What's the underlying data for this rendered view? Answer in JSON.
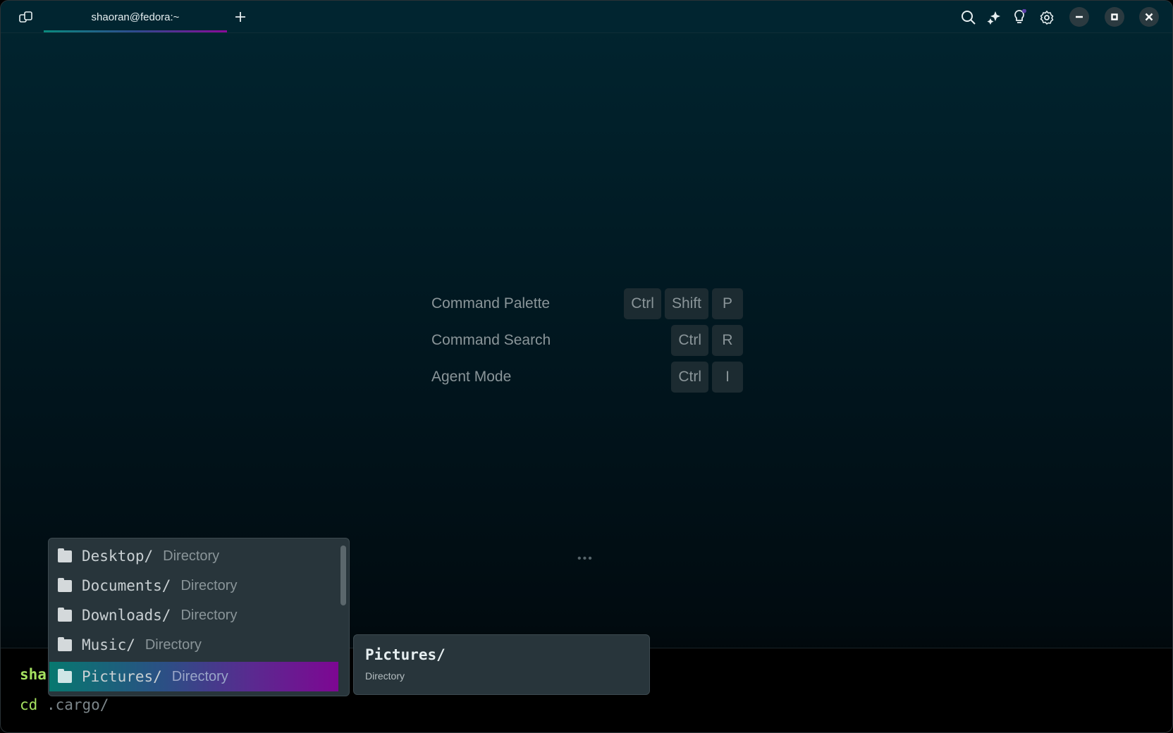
{
  "tab": {
    "title": "shaoran@fedora:~"
  },
  "toolbar": {
    "icons": [
      "panels-icon",
      "plus-icon",
      "search-icon",
      "sparkles-icon",
      "lightbulb-icon",
      "gear-icon",
      "minimize-icon",
      "maximize-icon",
      "close-icon"
    ],
    "notification_dot_color": "#5b3fa8"
  },
  "hints": [
    {
      "label": "Command Palette",
      "keys": [
        "Ctrl",
        "Shift",
        "P"
      ]
    },
    {
      "label": "Command Search",
      "keys": [
        "Ctrl",
        "R"
      ]
    },
    {
      "label": "Agent Mode",
      "keys": [
        "Ctrl",
        "I"
      ]
    }
  ],
  "terminal": {
    "prompt": "sha",
    "command": "cd",
    "suggestion": " .cargo/"
  },
  "completions": [
    {
      "name": "Desktop/",
      "type": "Directory"
    },
    {
      "name": "Documents/",
      "type": "Directory"
    },
    {
      "name": "Downloads/",
      "type": "Directory"
    },
    {
      "name": "Music/",
      "type": "Directory"
    },
    {
      "name": "Pictures/",
      "type": "Directory",
      "selected": true
    }
  ],
  "detail": {
    "name": "Pictures/",
    "type": "Directory"
  },
  "colors": {
    "accent_start": "#0a8a7e",
    "accent_end": "#8a0a9a",
    "prompt_green": "#a5e260"
  }
}
